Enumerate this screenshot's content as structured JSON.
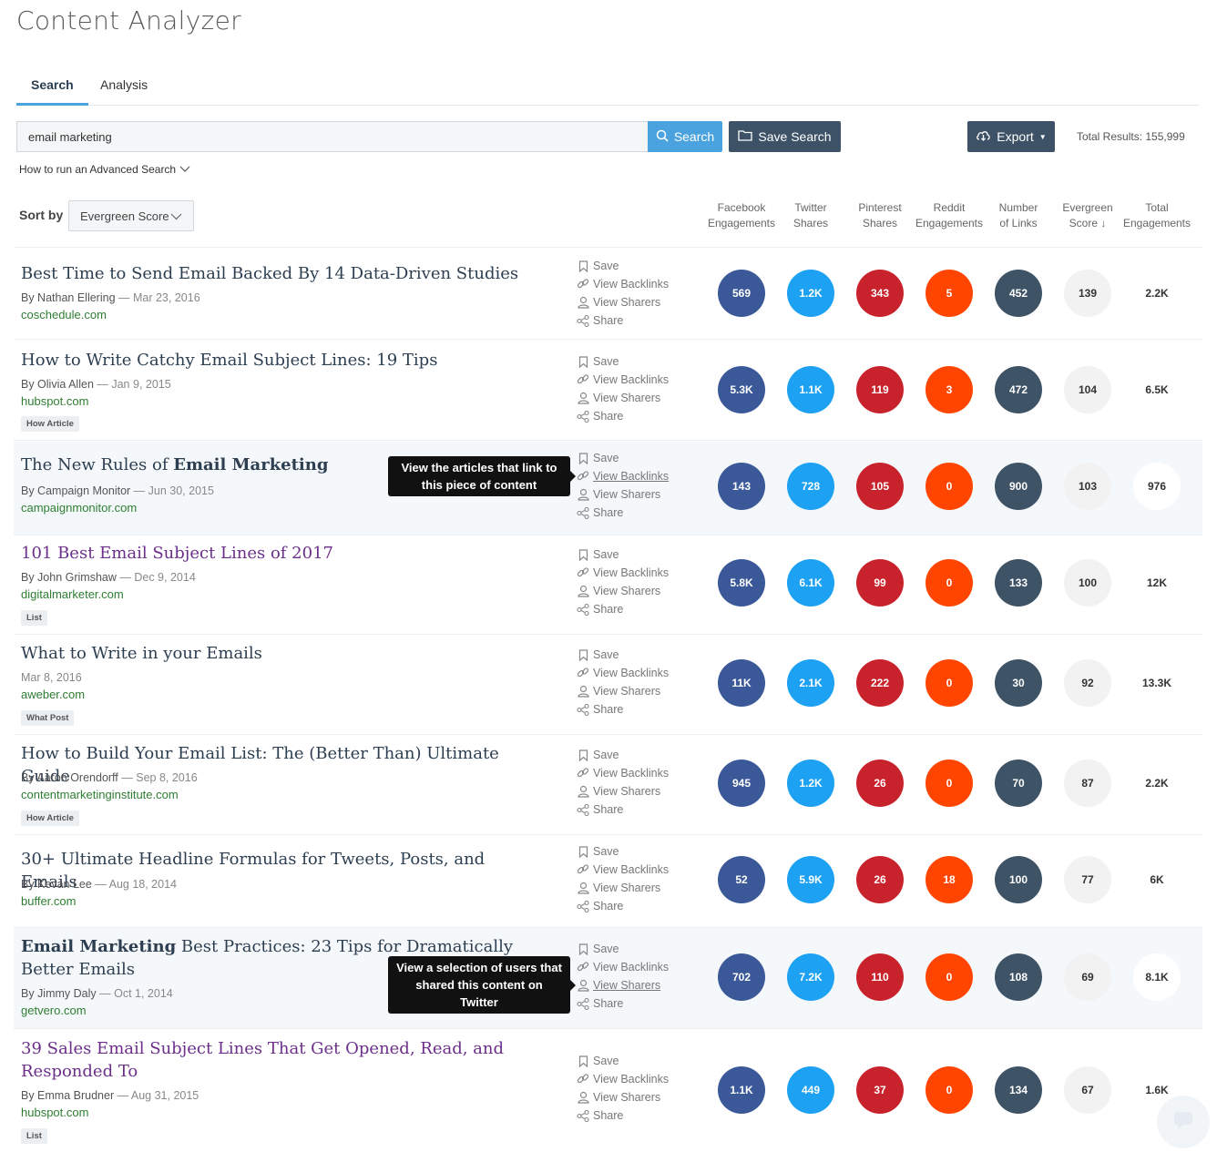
{
  "app": {
    "title": "Content Analyzer"
  },
  "tabs": [
    {
      "label": "Search"
    },
    {
      "label": "Analysis"
    }
  ],
  "search": {
    "value": "email marketing",
    "button": "Search",
    "save_button": "Save Search",
    "export_button": "Export",
    "total_results": "Total Results: 155,999",
    "advanced_link": "How to run an Advanced Search"
  },
  "sort": {
    "label": "Sort by",
    "selected": "Evergreen Score"
  },
  "columns": [
    {
      "line1": "Facebook",
      "line2": "Engagements"
    },
    {
      "line1": "Twitter",
      "line2": "Shares"
    },
    {
      "line1": "Pinterest",
      "line2": "Shares"
    },
    {
      "line1": "Reddit",
      "line2": "Engagements"
    },
    {
      "line1": "Number",
      "line2": "of Links"
    },
    {
      "line1": "Evergreen",
      "line2": "Score ↓"
    },
    {
      "line1": "Total",
      "line2": "Engagements"
    }
  ],
  "actions": {
    "save": "Save",
    "backlinks": "View Backlinks",
    "sharers": "View Sharers",
    "share": "Share"
  },
  "tooltips": {
    "backlinks": "View the articles that link to this piece of content",
    "sharers": "View a selection of users that shared this content on Twitter"
  },
  "results": [
    {
      "title": "Best Time to Send Email Backed By 14 Data-Driven Studies",
      "author": "By Nathan Ellering",
      "date": "Mar 23, 2016",
      "domain": "coschedule.com",
      "tag": "",
      "facebook": "569",
      "twitter": "1.2K",
      "pinterest": "343",
      "reddit": "5",
      "links": "452",
      "evergreen": "139",
      "total": "2.2K"
    },
    {
      "title": "How to Write Catchy Email Subject Lines: 19 Tips",
      "author": "By Olivia Allen",
      "date": "Jan 9, 2015",
      "domain": "hubspot.com",
      "tag": "How Article",
      "facebook": "5.3K",
      "twitter": "1.1K",
      "pinterest": "119",
      "reddit": "3",
      "links": "472",
      "evergreen": "104",
      "total": "6.5K"
    },
    {
      "title_pre": "The New Rules of ",
      "title_bold": "Email Marketing",
      "author": "By Campaign Monitor",
      "date": "Jun 30, 2015",
      "domain": "campaignmonitor.com",
      "tag": "",
      "facebook": "143",
      "twitter": "728",
      "pinterest": "105",
      "reddit": "0",
      "links": "900",
      "evergreen": "103",
      "total": "976"
    },
    {
      "title": "101 Best Email Subject Lines of 2017",
      "author": "By John Grimshaw",
      "date": "Dec 9, 2014",
      "domain": "digitalmarketer.com",
      "tag": "List",
      "facebook": "5.8K",
      "twitter": "6.1K",
      "pinterest": "99",
      "reddit": "0",
      "links": "133",
      "evergreen": "100",
      "total": "12K"
    },
    {
      "title": "What to Write in your Emails",
      "author": "",
      "date": "Mar 8, 2016",
      "domain": "aweber.com",
      "tag": "What Post",
      "facebook": "11K",
      "twitter": "2.1K",
      "pinterest": "222",
      "reddit": "0",
      "links": "30",
      "evergreen": "92",
      "total": "13.3K"
    },
    {
      "title": "How to Build Your Email List: The (Better Than) Ultimate Guide",
      "author": "By Aaron Orendorff",
      "date": "Sep 8, 2016",
      "domain": "contentmarketinginstitute.com",
      "tag": "How Article",
      "facebook": "945",
      "twitter": "1.2K",
      "pinterest": "26",
      "reddit": "0",
      "links": "70",
      "evergreen": "87",
      "total": "2.2K"
    },
    {
      "title": "30+ Ultimate Headline Formulas for Tweets, Posts, and Emails",
      "author": "By Kevan Lee",
      "date": "Aug 18, 2014",
      "domain": "buffer.com",
      "tag": "",
      "facebook": "52",
      "twitter": "5.9K",
      "pinterest": "26",
      "reddit": "18",
      "links": "100",
      "evergreen": "77",
      "total": "6K"
    },
    {
      "title_bold": "Email Marketing",
      "title_post": " Best Practices: 23 Tips for Dramatically Better Emails",
      "author": "By Jimmy Daly",
      "date": "Oct 1, 2014",
      "domain": "getvero.com",
      "tag": "",
      "facebook": "702",
      "twitter": "7.2K",
      "pinterest": "110",
      "reddit": "0",
      "links": "108",
      "evergreen": "69",
      "total": "8.1K"
    },
    {
      "title": "39 Sales Email Subject Lines That Get Opened, Read, and Responded To",
      "author": "By Emma Brudner",
      "date": "Aug 31, 2015",
      "domain": "hubspot.com",
      "tag": "List",
      "facebook": "1.1K",
      "twitter": "449",
      "pinterest": "37",
      "reddit": "0",
      "links": "134",
      "evergreen": "67",
      "total": "1.6K"
    }
  ],
  "colors": {
    "facebook": "#3b5998",
    "twitter": "#1da1f2",
    "pinterest": "#c8232c",
    "reddit": "#ff4500",
    "links": "#3e5366",
    "accent": "#4aa3df",
    "dark_button": "#3d5266"
  },
  "icons": {
    "search": "search-icon",
    "folder": "folder-icon",
    "cloud": "cloud-download-icon",
    "bookmark": "bookmark-icon",
    "link": "link-icon",
    "user": "user-icon",
    "share": "share-icon",
    "chat": "chat-icon"
  }
}
